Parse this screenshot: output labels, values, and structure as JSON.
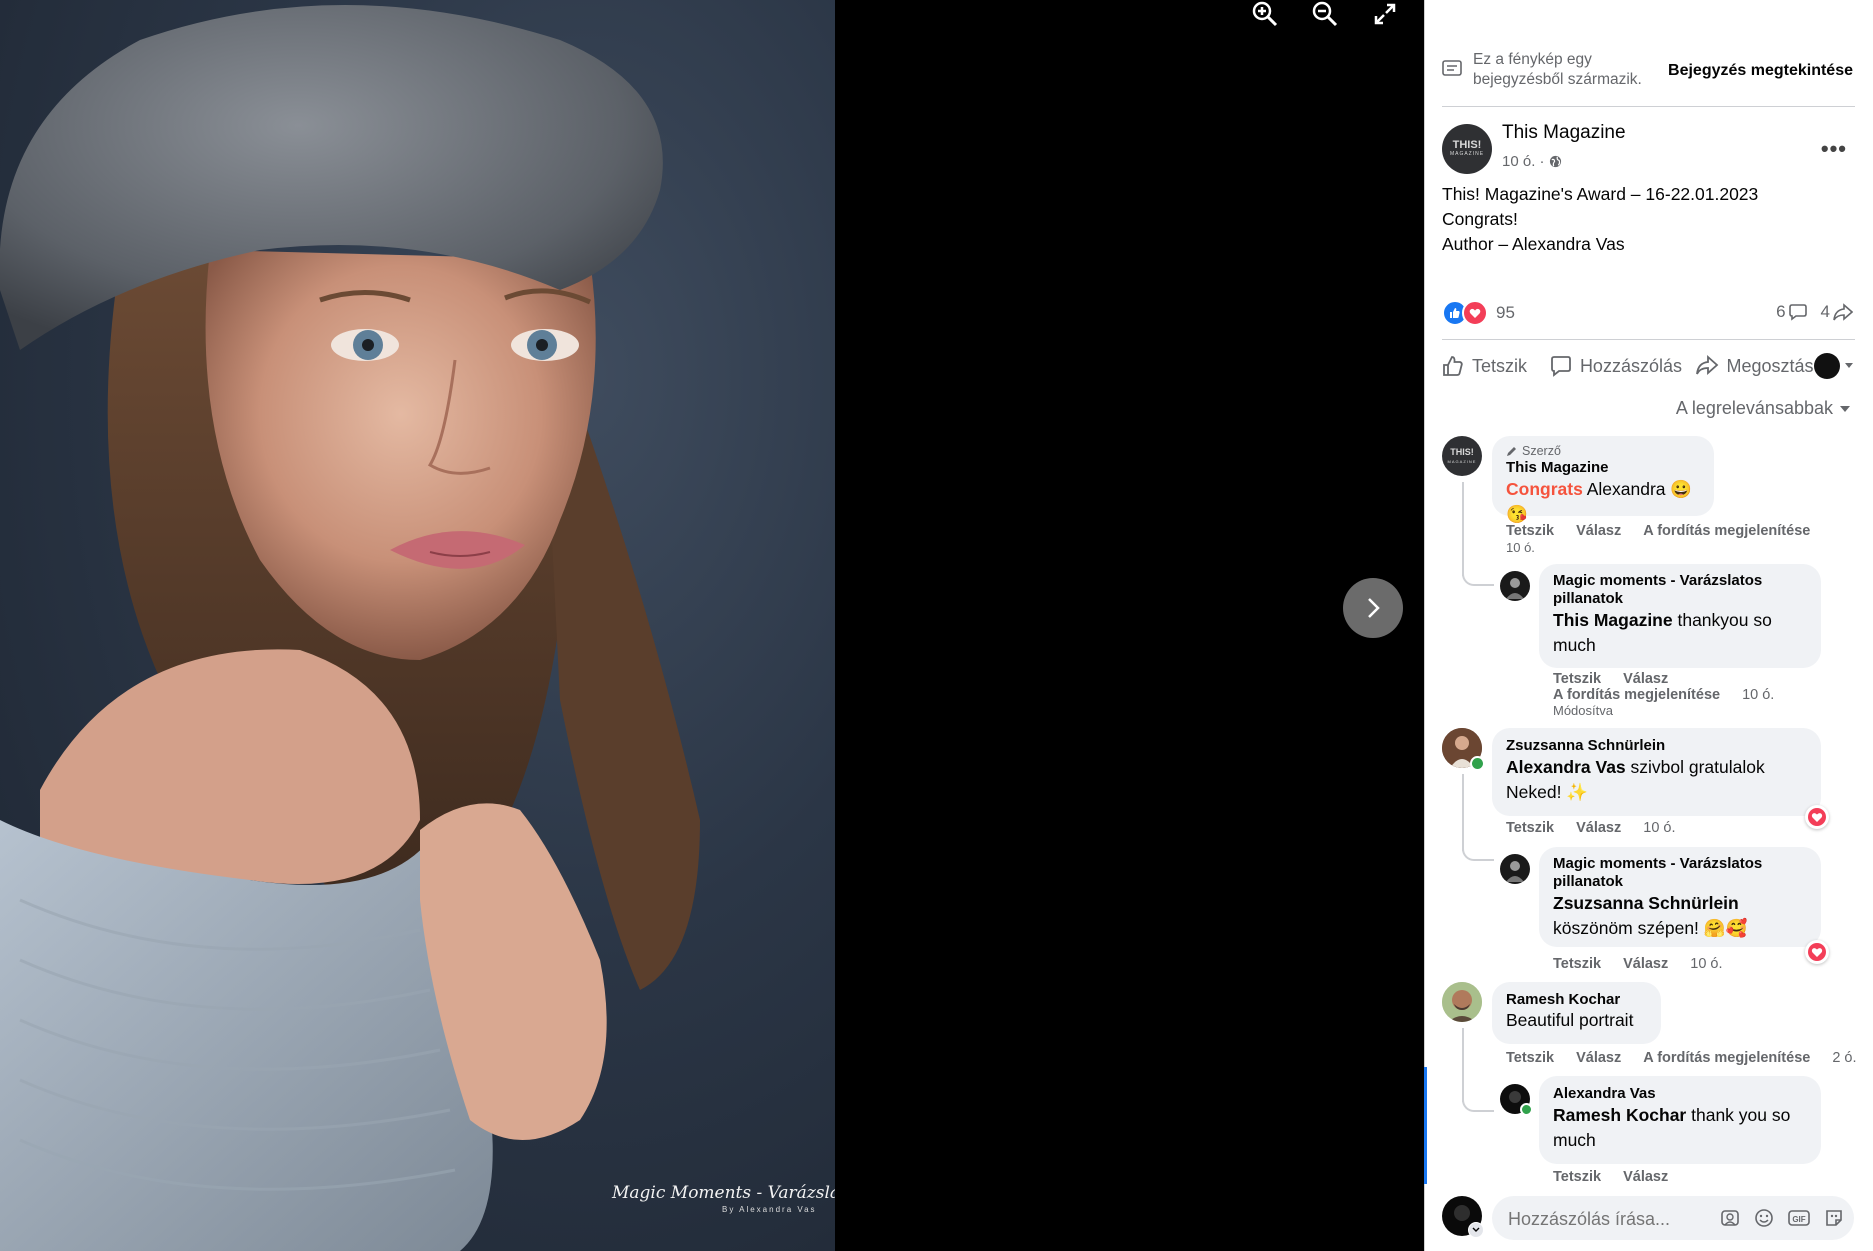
{
  "viewer": {
    "watermark": "Magic Moments - Varázslatos pillanatok",
    "watermark_sub": "By Alexandra Vas",
    "zoom_in_icon": "zoom-in-icon",
    "zoom_out_icon": "zoom-out-icon",
    "fullscreen_icon": "fullscreen-icon",
    "next_icon": "chevron-right-icon"
  },
  "post_origin": {
    "text": "Ez a fénykép egy bejegyzésből származik.",
    "view_post": "Bejegyzés megtekintése"
  },
  "post": {
    "author": "This Magazine",
    "avatar_line1": "THIS!",
    "avatar_line2": "MAGAZINE",
    "time": "10 ó. ·",
    "text_line1": "This! Magazine's Award – 16-22.01.2023",
    "text_line2": "Congrats!",
    "text_line3": "Author – Alexandra Vas",
    "reaction_count": "95",
    "comment_count": "6",
    "share_count": "4"
  },
  "actions": {
    "like": "Tetszik",
    "comment": "Hozzászólás",
    "share": "Megosztás"
  },
  "sort_label": "A legrelevánsabbak",
  "comments": [
    {
      "author_badge": "Szerző",
      "name": "This Magazine",
      "highlight": "Congrats",
      "body": " Alexandra 😀 😘",
      "like": "Tetszik",
      "reply": "Válasz",
      "translate": "A fordítás megjelenítése",
      "time": "10 ó."
    },
    {
      "name": "Magic moments - Varázslatos pillanatok",
      "mention": "This Magazine",
      "body": " thankyou so much",
      "like": "Tetszik",
      "reply": "Válasz",
      "translate": "A fordítás megjelenítése",
      "time": "10 ó.",
      "edited": "Módosítva"
    },
    {
      "name": "Zsuzsanna Schnürlein",
      "mention": "Alexandra Vas",
      "body": " szivbol gratulalok Neked! ✨",
      "like": "Tetszik",
      "reply": "Válasz",
      "time": "10 ó."
    },
    {
      "name": "Magic moments - Varázslatos pillanatok",
      "mention": "Zsuzsanna Schnürlein",
      "body": "köszönöm szépen! 🤗🥰",
      "like": "Tetszik",
      "reply": "Válasz",
      "time": "10 ó."
    },
    {
      "name": "Ramesh Kochar",
      "body": "Beautiful portrait",
      "like": "Tetszik",
      "reply": "Válasz",
      "translate": "A fordítás megjelenítése",
      "time": "2 ó."
    },
    {
      "name": "Alexandra Vas",
      "mention": "Ramesh Kochar",
      "body": " thank you so much",
      "like": "Tetszik",
      "reply": "Válasz"
    }
  ],
  "comment_input": {
    "placeholder": "Hozzászólás írása..."
  },
  "colors": {
    "like_blue": "#1877f2",
    "love_red": "#f33e58",
    "highlight": "#f5533d",
    "online": "#31a24c"
  }
}
